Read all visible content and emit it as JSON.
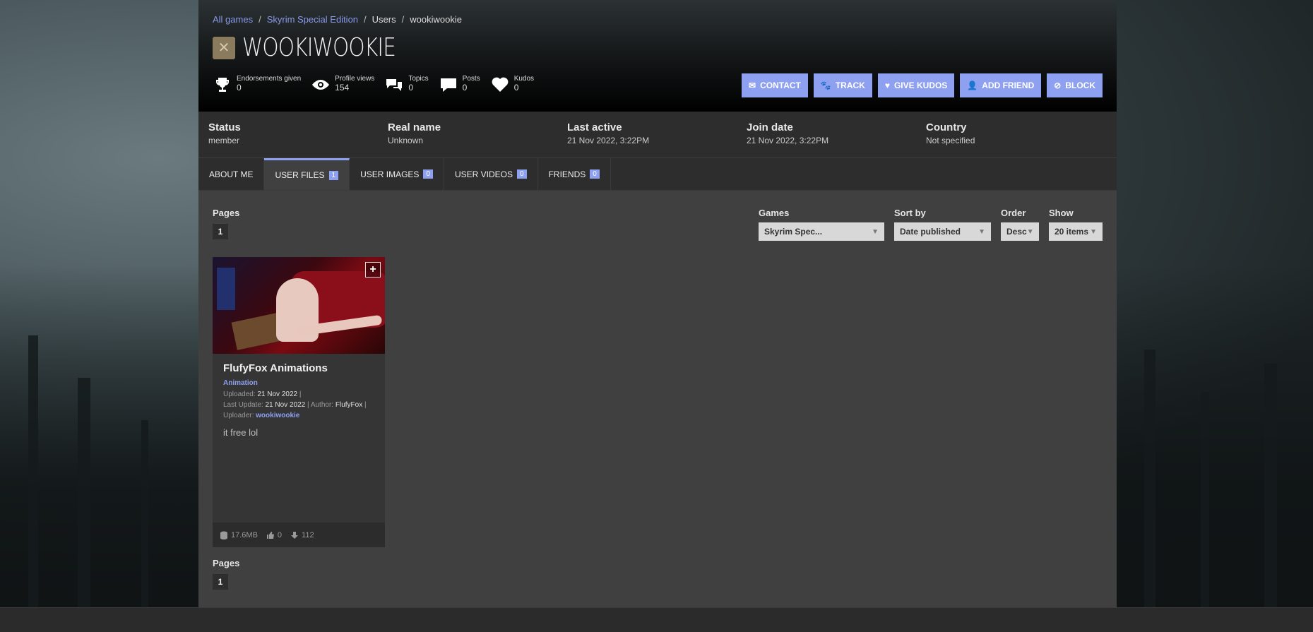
{
  "breadcrumbs": [
    "All games",
    "Skyrim Special Edition",
    "Users",
    "wookiwookie"
  ],
  "profile": {
    "username": "WOOKIWOOKIE",
    "stats": [
      {
        "label": "Endorsements given",
        "value": "0",
        "icon": "trophy-icon"
      },
      {
        "label": "Profile views",
        "value": "154",
        "icon": "eye-icon"
      },
      {
        "label": "Topics",
        "value": "0",
        "icon": "topics-icon"
      },
      {
        "label": "Posts",
        "value": "0",
        "icon": "posts-icon"
      },
      {
        "label": "Kudos",
        "value": "0",
        "icon": "heart-icon"
      }
    ],
    "actions": [
      "CONTACT",
      "TRACK",
      "GIVE KUDOS",
      "ADD FRIEND",
      "BLOCK"
    ]
  },
  "info": [
    {
      "key": "Status",
      "value": "member"
    },
    {
      "key": "Real name",
      "value": "Unknown"
    },
    {
      "key": "Last active",
      "value": "21 Nov 2022,  3:22PM"
    },
    {
      "key": "Join date",
      "value": "21 Nov 2022,  3:22PM"
    },
    {
      "key": "Country",
      "value": "Not specified"
    }
  ],
  "tabs": [
    {
      "label": "ABOUT ME",
      "count": ""
    },
    {
      "label": "USER FILES",
      "count": "1"
    },
    {
      "label": "USER IMAGES",
      "count": "0"
    },
    {
      "label": "USER VIDEOS",
      "count": "0"
    },
    {
      "label": "FRIENDS",
      "count": "0"
    }
  ],
  "listing": {
    "pages_label": "Pages",
    "page": "1",
    "filters": {
      "games_label": "Games",
      "games_value": "Skyrim Spec...",
      "sort_label": "Sort by",
      "sort_value": "Date published",
      "order_label": "Order",
      "order_value": "Desc",
      "show_label": "Show",
      "show_value": "20 items"
    }
  },
  "file": {
    "title": "FlufyFox Animations",
    "category": "Animation",
    "uploaded_label": "Uploaded:",
    "uploaded": "21 Nov 2022",
    "last_update_label": "Last Update:",
    "last_update": "21 Nov 2022",
    "author_label": "Author:",
    "author": "FlufyFox",
    "uploader_label": "Uploader:",
    "uploader": "wookiwookie",
    "description": "it free lol",
    "size": "17.6MB",
    "endorsements": "0",
    "downloads": "112"
  },
  "colors": {
    "accent": "#8ea0f0",
    "panel": "#2d2d2d",
    "content": "#404040"
  }
}
